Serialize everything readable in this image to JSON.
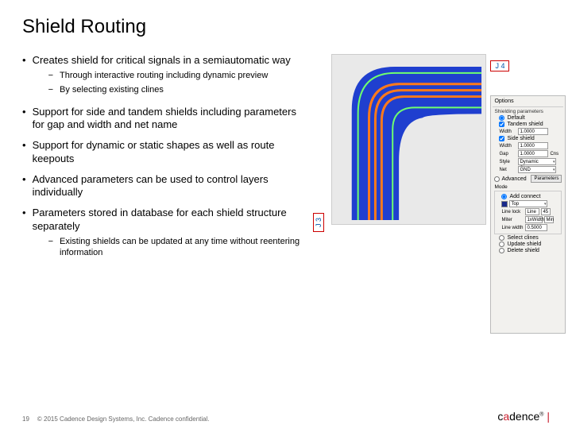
{
  "title": "Shield Routing",
  "bullets": [
    {
      "text": "Creates shield for critical signals in a semiautomatic way",
      "sub": [
        "Through interactive routing including dynamic preview",
        "By selecting existing clines"
      ]
    },
    {
      "text": "Support for side and tandem shields including parameters for gap and width and net name"
    },
    {
      "text": "Support for dynamic or static shapes as well as route keepouts"
    },
    {
      "text": "Advanced parameters can be used to control layers individually"
    },
    {
      "text": "Parameters stored in database for each shield structure separately",
      "sub": [
        "Existing shields can be updated at any time without reentering information"
      ]
    }
  ],
  "labels": {
    "j3": "J 3",
    "j4": "J 4"
  },
  "panel": {
    "header": "Options",
    "shielding_params": "Shielding parameters",
    "default": "Default",
    "tandem": "Tandem shield",
    "side": "Side shield",
    "width_lbl": "Width",
    "width_val": "1.0000",
    "gap_lbl": "Gap",
    "gap_val": "1.0000",
    "style_lbl": "Style",
    "style_val": "Dynamic Shape",
    "net_lbl": "Net",
    "net_val": "GND",
    "cns_lbl": "Cns",
    "advanced": "Advanced",
    "parameters": "Parameters",
    "mode": "Mode",
    "add_connect": "Add connect",
    "top": "Top",
    "line_lock": "Line lock",
    "line": "Line",
    "angle": "45",
    "miter_lbl": "Miter",
    "miter_val": "1xWidth",
    "miter_min": "Min",
    "line_width_lbl": "Line width",
    "line_width_val": "0.5000",
    "select_clines": "Select clines",
    "update_shield": "Update shield",
    "delete_shield": "Delete shield"
  },
  "footer": {
    "page": "19",
    "copyright": "© 2015 Cadence Design Systems, Inc. Cadence confidential.",
    "logo_c": "c",
    "logo_a": "a",
    "logo_rest": "dence",
    "logo_bar": " |",
    "logo_reg": "®"
  }
}
